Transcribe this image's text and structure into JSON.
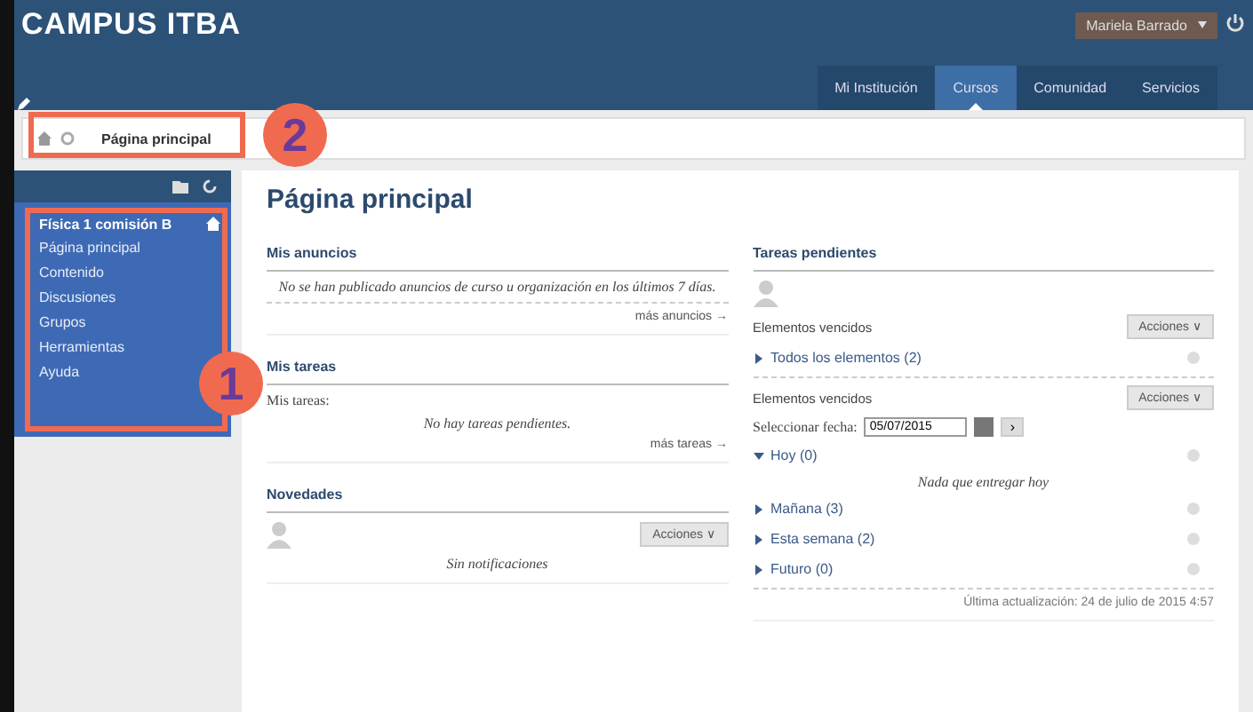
{
  "header": {
    "logo": "CAMPUS ITBA",
    "user": "Mariela Barrado",
    "nav": [
      {
        "label": "Mi Institución",
        "selected": false
      },
      {
        "label": "Cursos",
        "selected": true
      },
      {
        "label": "Comunidad",
        "selected": false
      },
      {
        "label": "Servicios",
        "selected": false
      }
    ]
  },
  "breadcrumb": {
    "label": "Página principal"
  },
  "sidebar": {
    "title": "Física 1 comisión B",
    "items": [
      "Página principal",
      "Contenido",
      "Discusiones",
      "Grupos",
      "Herramientas",
      "Ayuda"
    ]
  },
  "page_title": "Página principal",
  "left_modules": [
    {
      "title": "Mis anuncios",
      "kind": "announcements",
      "message": "No se han publicado anuncios de curso u organización en los últimos 7 días.",
      "link": "más anuncios →"
    },
    {
      "title": "Mis tareas",
      "kind": "tasks",
      "intro": "Mis tareas:",
      "message": "No hay tareas pendientes.",
      "link": "más tareas →"
    },
    {
      "title": "Novedades",
      "kind": "news",
      "button": "Acciones ∨",
      "message": "Sin notificaciones"
    }
  ],
  "pending": {
    "title": "Tareas pendientes",
    "overdue_label": "Elementos vencidos",
    "actions": "Acciones ∨",
    "all_items": "Todos los elementos (2)",
    "due_label": "Elementos vencidos",
    "actions2": "Acciones ∨",
    "date_label": "Seleccionar fecha:",
    "date_value": "05/07/2015",
    "go": "›",
    "groups": [
      {
        "label": "Hoy (0)",
        "expanded": true,
        "empty": "Nada que entregar hoy"
      },
      {
        "label": "Mañana (3)",
        "expanded": false
      },
      {
        "label": "Esta semana (2)",
        "expanded": false
      },
      {
        "label": "Futuro (0)",
        "expanded": false
      }
    ],
    "updated": "Última actualización: 24 de julio de 2015 4:57"
  },
  "callouts": [
    "1",
    "2"
  ]
}
